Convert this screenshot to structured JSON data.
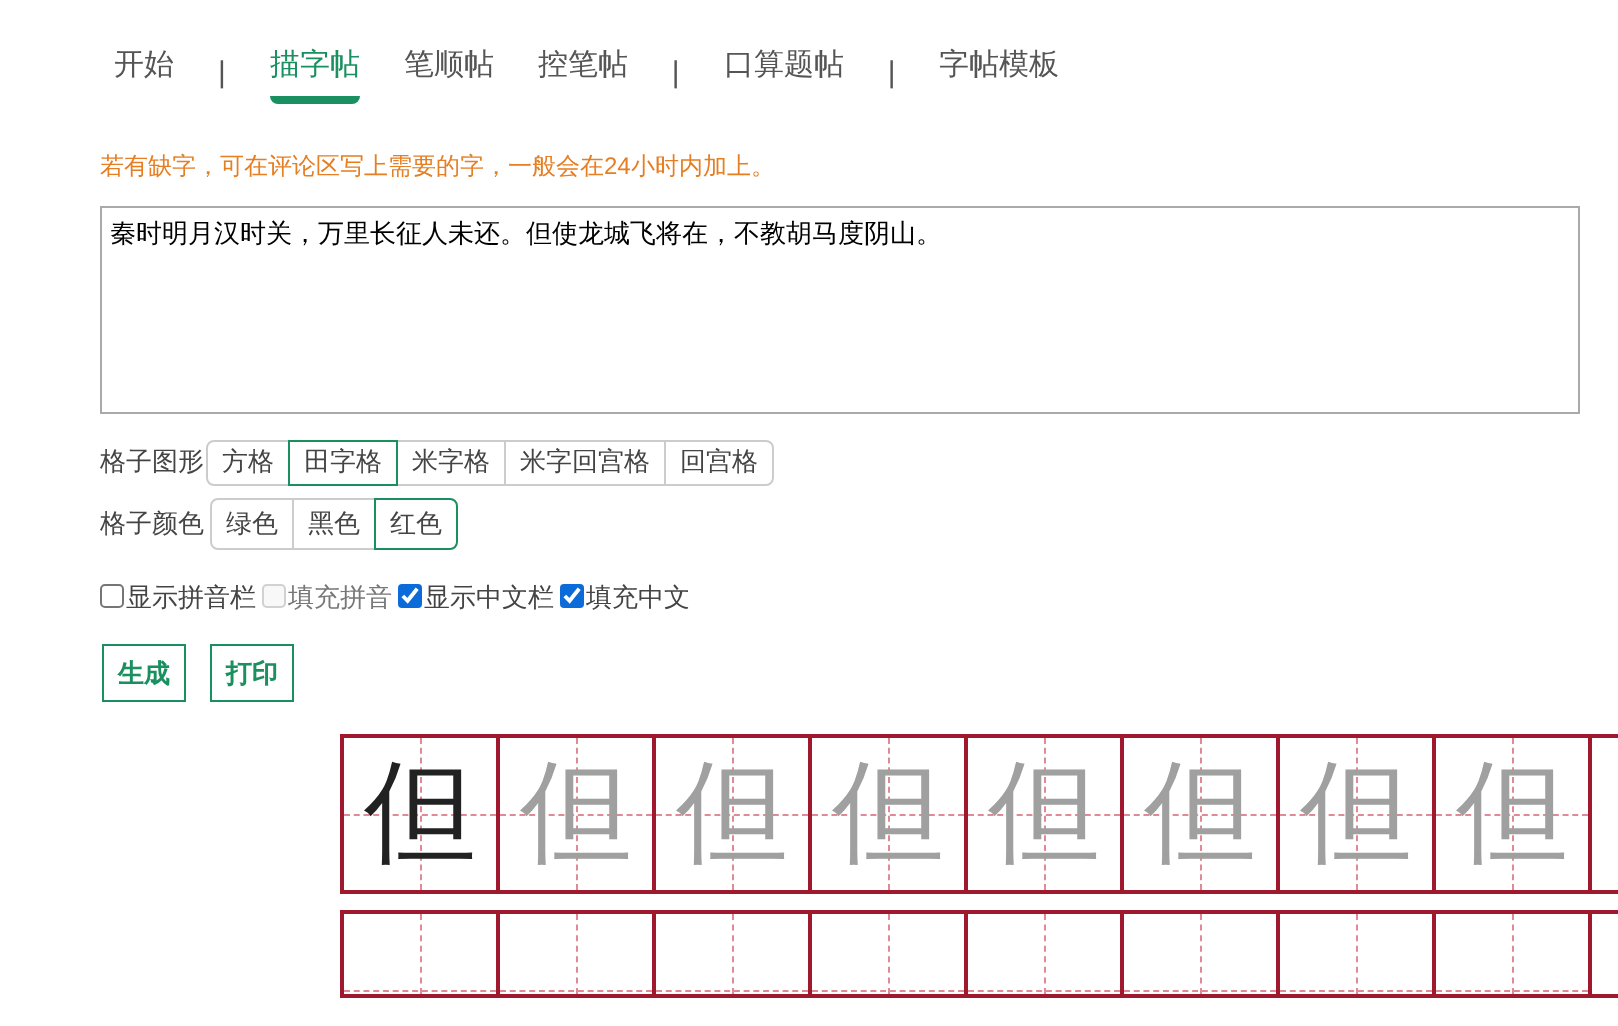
{
  "nav": [
    {
      "kind": "link",
      "label": "开始",
      "selected": false
    },
    {
      "kind": "separator",
      "label": "|"
    },
    {
      "kind": "link",
      "label": "描字帖",
      "selected": true
    },
    {
      "kind": "link",
      "label": "笔顺帖",
      "selected": false
    },
    {
      "kind": "link",
      "label": "控笔帖",
      "selected": false
    },
    {
      "kind": "separator",
      "label": "|"
    },
    {
      "kind": "link",
      "label": "口算题帖",
      "selected": false
    },
    {
      "kind": "separator",
      "label": "|"
    },
    {
      "kind": "link",
      "label": "字帖模板",
      "selected": false
    }
  ],
  "notice": "若有缺字，可在评论区写上需要的字，一般会在24小时内加上。",
  "text_input": {
    "value": "秦时明月汉时关，万里长征人未还。但使龙城飞将在，不教胡马度阴山。"
  },
  "grid_shape": {
    "label": "格子图形",
    "options": [
      {
        "label": "方格",
        "selected": false
      },
      {
        "label": "田字格",
        "selected": true
      },
      {
        "label": "米字格",
        "selected": false
      },
      {
        "label": "米字回宫格",
        "selected": false
      },
      {
        "label": "回宫格",
        "selected": false
      }
    ]
  },
  "grid_color": {
    "label": "格子颜色",
    "options": [
      {
        "label": "绿色",
        "selected": false
      },
      {
        "label": "黑色",
        "selected": false
      },
      {
        "label": "红色",
        "selected": true
      }
    ]
  },
  "checkboxes": [
    {
      "label": "显示拼音栏",
      "checked": false,
      "disabled": false
    },
    {
      "label": "填充拼音",
      "checked": false,
      "disabled": true
    },
    {
      "label": "显示中文栏",
      "checked": true,
      "disabled": false
    },
    {
      "label": "填充中文",
      "checked": true,
      "disabled": false
    }
  ],
  "buttons": [
    "生成",
    "打印"
  ],
  "sheet": {
    "rows": [
      {
        "cells": [
          {
            "text": "但",
            "kind": "model"
          },
          {
            "text": "但",
            "kind": "trace"
          },
          {
            "text": "但",
            "kind": "trace"
          },
          {
            "text": "但",
            "kind": "trace"
          },
          {
            "text": "但",
            "kind": "trace"
          },
          {
            "text": "但",
            "kind": "trace"
          },
          {
            "text": "但",
            "kind": "trace"
          },
          {
            "text": "但",
            "kind": "trace"
          }
        ]
      },
      {
        "cells": [
          {
            "kind": "blank"
          },
          {
            "kind": "blank"
          },
          {
            "kind": "blank"
          },
          {
            "kind": "blank"
          },
          {
            "kind": "blank"
          },
          {
            "kind": "blank"
          },
          {
            "kind": "blank"
          },
          {
            "kind": "blank"
          }
        ]
      }
    ]
  }
}
